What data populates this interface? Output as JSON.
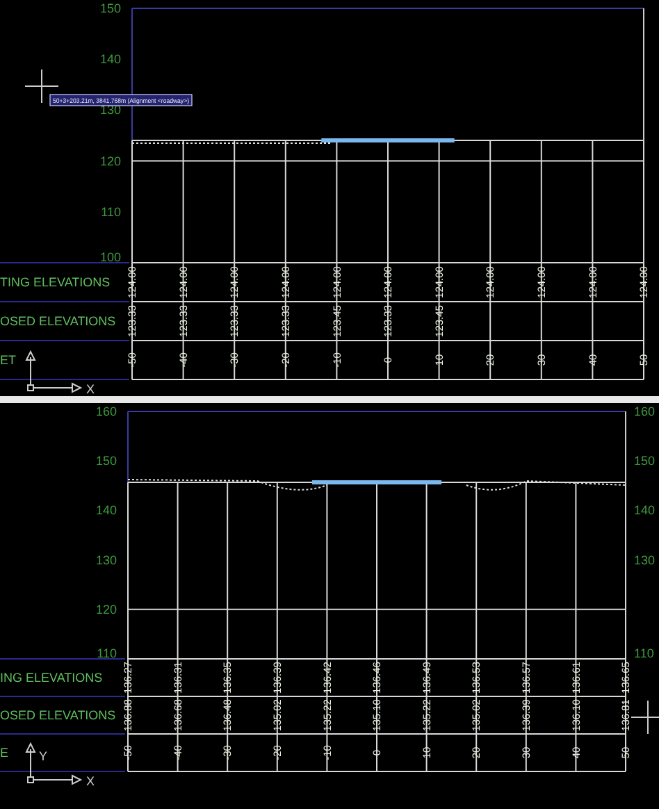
{
  "panels": [
    {
      "left_axis": [
        "150",
        "140",
        "130",
        "120",
        "110",
        "100"
      ],
      "tooltip": "50+3+203.21m, 3841.768m (Alignment <roadway>)",
      "bands": [
        {
          "label": "TING ELEVATIONS",
          "values": [
            "124.00",
            "124.00",
            "124.00",
            "124.00",
            "124.00",
            "124.00",
            "124.00",
            "124.00",
            "124.00",
            "124.00",
            "124.00"
          ]
        },
        {
          "label": "OSED ELEVATIONS",
          "values": [
            "123.33",
            "123.33",
            "123.33",
            "123.33",
            "123.45",
            "123.33",
            "123.45"
          ]
        },
        {
          "label": "ET",
          "values": [
            "-50",
            "-40",
            "-30",
            "-20",
            "-10",
            "0",
            "10",
            "20",
            "30",
            "40",
            "50"
          ]
        }
      ],
      "axis_letters": [
        "X"
      ]
    },
    {
      "left_axis": [
        "160",
        "150",
        "140",
        "130",
        "120",
        "110"
      ],
      "right_axis": [
        "160",
        "150",
        "140",
        "130",
        "110"
      ],
      "bands": [
        {
          "label": "ING ELEVATIONS",
          "values": [
            "136.27",
            "136.31",
            "136.35",
            "136.39",
            "136.42",
            "136.46",
            "136.49",
            "136.53",
            "136.57",
            "136.61",
            "136.65"
          ]
        },
        {
          "label": "OSED ELEVATIONS",
          "values": [
            "136.88",
            "136.68",
            "136.48",
            "135.02",
            "135.22",
            "135.10",
            "135.22",
            "135.02",
            "136.39",
            "136.10",
            "136.81"
          ]
        },
        {
          "label": "E",
          "values": [
            "-50",
            "-40",
            "-30",
            "-20",
            "-10",
            "0",
            "10",
            "20",
            "30",
            "40",
            "50"
          ]
        }
      ],
      "axis_letters": [
        "Y",
        "X"
      ]
    }
  ]
}
